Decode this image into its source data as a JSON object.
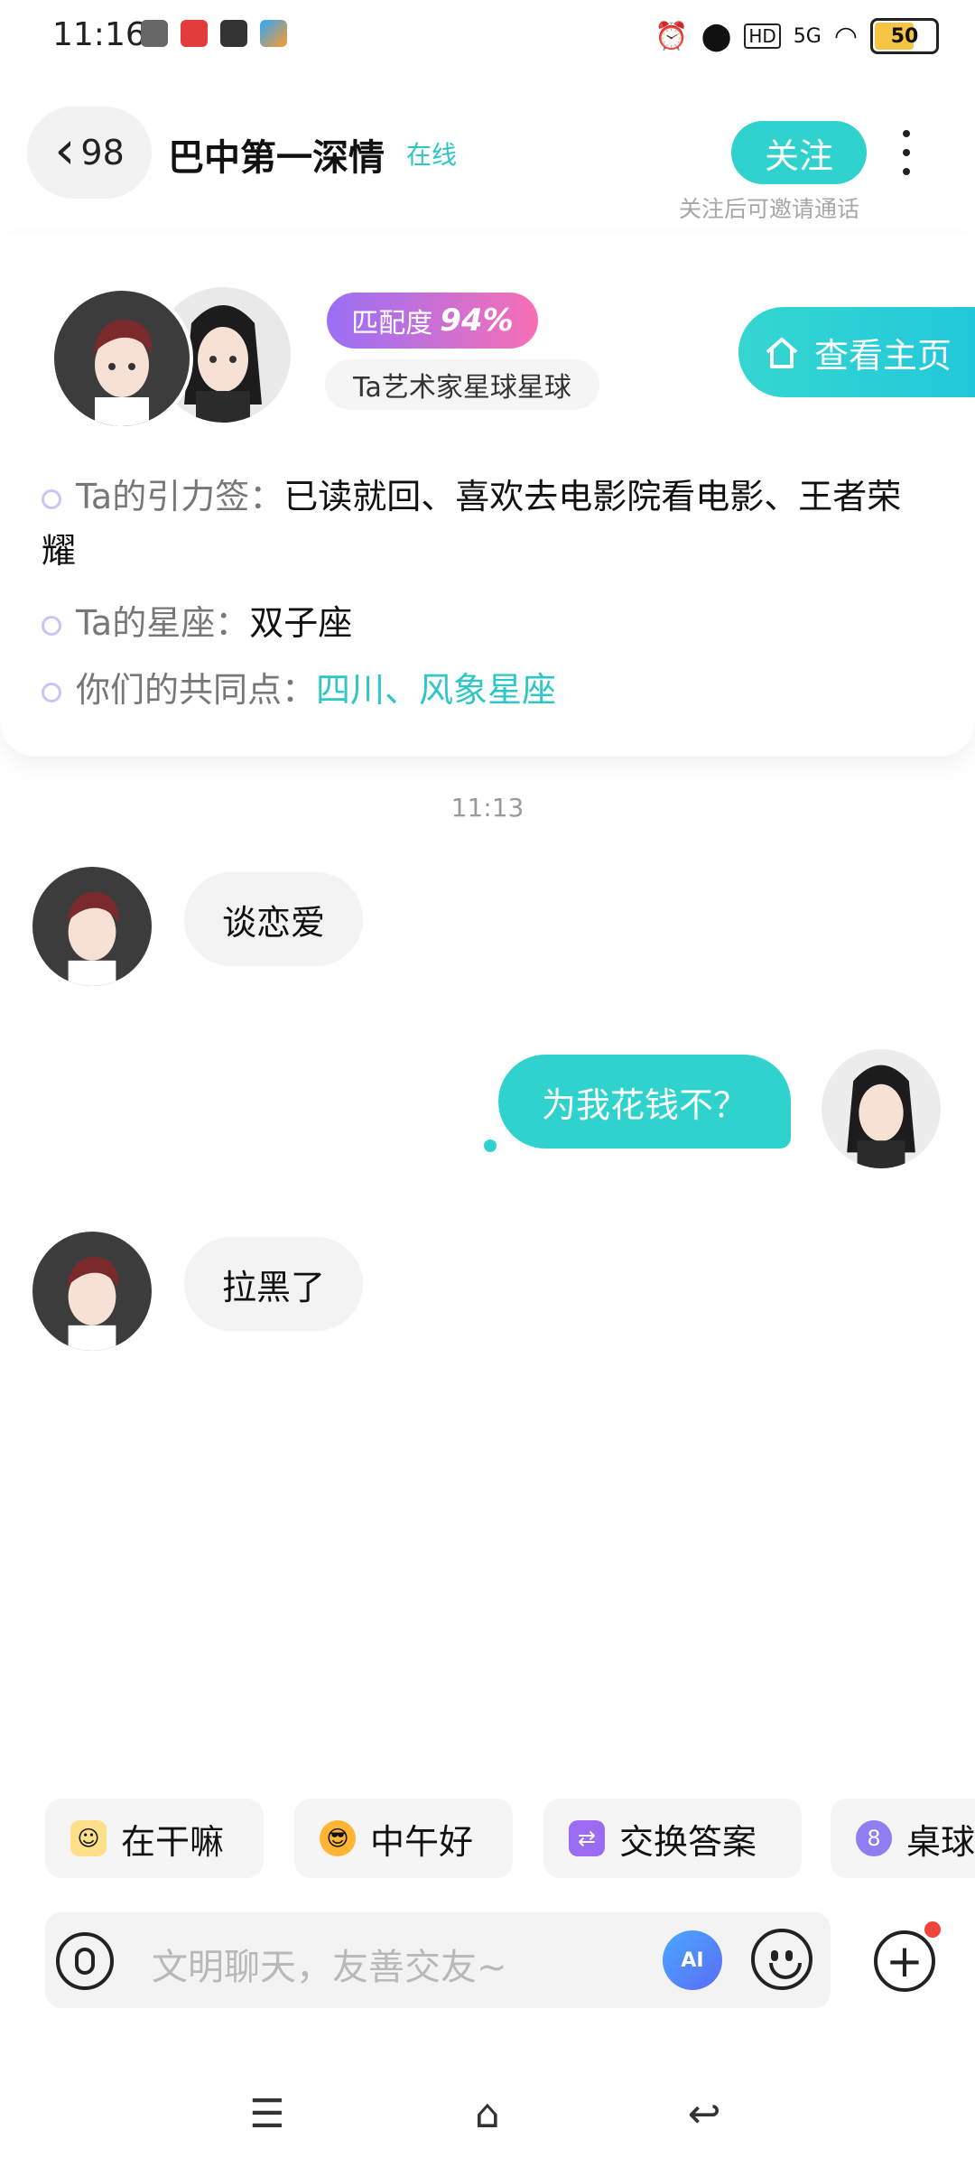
{
  "status_bar": {
    "time": "11:16",
    "battery": "50",
    "network": "5G",
    "hd": "HD"
  },
  "header": {
    "back_count": "98",
    "title": "巴中第一深情",
    "online_status": "在线",
    "follow_label": "关注",
    "follow_hint": "关注后可邀请通话"
  },
  "profile_card": {
    "match_label": "匹配度",
    "match_value": "94%",
    "planet": "Ta艺术家星球星球",
    "home_button": "查看主页",
    "attraction_label": "Ta的引力签：",
    "attraction_value": "已读就回、喜欢去电影院看电影、王者荣耀",
    "zodiac_label": "Ta的星座：",
    "zodiac_value": "双子座",
    "common_label": "你们的共同点：",
    "common_value": "四川、风象星座"
  },
  "chat": {
    "timestamp": "11:13",
    "messages": [
      {
        "from": "other",
        "text": "谈恋爱"
      },
      {
        "from": "me",
        "text": "为我花钱不？"
      },
      {
        "from": "other",
        "text": "拉黑了"
      }
    ]
  },
  "quick_replies": [
    {
      "label": "在干嘛",
      "icon": "star-face-icon"
    },
    {
      "label": "中午好",
      "icon": "sunglasses-face-icon"
    },
    {
      "label": "交换答案",
      "icon": "swap-icon"
    },
    {
      "label": "桌球",
      "icon": "billiard-ball-icon"
    }
  ],
  "input": {
    "placeholder": "文明聊天，友善交友~",
    "ai_label": "AI"
  },
  "colors": {
    "accent": "#2fd2cc",
    "match_gradient_start": "#9a6ff7",
    "match_gradient_end": "#f76fb4"
  }
}
